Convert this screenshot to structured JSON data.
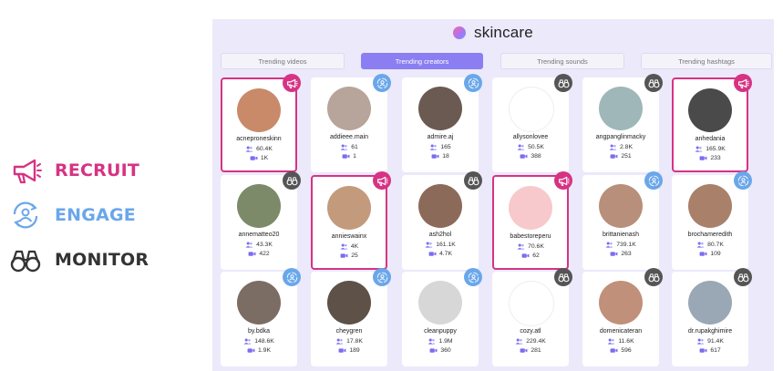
{
  "legend": {
    "recruit": {
      "label": "RECRUIT",
      "color": "#d63384",
      "icon": "megaphone-icon"
    },
    "engage": {
      "label": "ENGAGE",
      "color": "#6aa7ea",
      "icon": "person-cycle-icon"
    },
    "monitor": {
      "label": "MONITOR",
      "color": "#333333",
      "icon": "binoculars-icon"
    }
  },
  "app": {
    "title": "skincare",
    "tabs": [
      "Trending videos",
      "Trending creators",
      "Trending sounds",
      "Trending hashtags"
    ],
    "active_tab": "Trending creators"
  },
  "creators": [
    {
      "username": "acneproneskinn",
      "followers": "60.4K",
      "videos": "1K",
      "badge": "recruit",
      "avatar": "#c98a6a"
    },
    {
      "username": "addieee.main",
      "followers": "61",
      "videos": "1",
      "badge": "engage",
      "avatar": "#b7a49a"
    },
    {
      "username": "admire.aj",
      "followers": "165",
      "videos": "18",
      "badge": "engage",
      "avatar": "#6b5a52"
    },
    {
      "username": "allysonlovee",
      "followers": "50.5K",
      "videos": "388",
      "badge": "monitor",
      "avatar": "#ffffff"
    },
    {
      "username": "angpanglinmacky",
      "followers": "2.8K",
      "videos": "251",
      "badge": "monitor",
      "avatar": "#9fb7b8"
    },
    {
      "username": "anhedania",
      "followers": "165.9K",
      "videos": "233",
      "badge": "recruit",
      "avatar": "#4a4a4a"
    },
    {
      "username": "annematteo20",
      "followers": "43.3K",
      "videos": "422",
      "badge": "monitor",
      "avatar": "#7c8a6a"
    },
    {
      "username": "annieswainx",
      "followers": "4K",
      "videos": "25",
      "badge": "recruit",
      "avatar": "#c49a7c"
    },
    {
      "username": "ash2hol",
      "followers": "161.1K",
      "videos": "4.7K",
      "badge": "monitor",
      "avatar": "#8c6a5a"
    },
    {
      "username": "babestoreperu",
      "followers": "70.6K",
      "videos": "62",
      "badge": "recruit",
      "avatar": "#f7c9cc"
    },
    {
      "username": "brittanienash",
      "followers": "739.1K",
      "videos": "263",
      "badge": "engage",
      "avatar": "#b88f7a"
    },
    {
      "username": "brochameredith",
      "followers": "80.7K",
      "videos": "109",
      "badge": "engage",
      "avatar": "#a9806a"
    },
    {
      "username": "by.bdka",
      "followers": "148.6K",
      "videos": "1.9K",
      "badge": "engage",
      "avatar": "#7b6d64"
    },
    {
      "username": "cheygren",
      "followers": "17.8K",
      "videos": "189",
      "badge": "engage",
      "avatar": "#5d5148"
    },
    {
      "username": "cleanpuppy",
      "followers": "1.9M",
      "videos": "360",
      "badge": "engage",
      "avatar": "#d7d7d7"
    },
    {
      "username": "cozy.atl",
      "followers": "229.4K",
      "videos": "281",
      "badge": "monitor",
      "avatar": "#ffffff"
    },
    {
      "username": "domenicateran",
      "followers": "11.6K",
      "videos": "596",
      "badge": "monitor",
      "avatar": "#c0907a"
    },
    {
      "username": "dr.rupakghimire",
      "followers": "91.4K",
      "videos": "617",
      "badge": "monitor",
      "avatar": "#9aa7b5"
    }
  ]
}
